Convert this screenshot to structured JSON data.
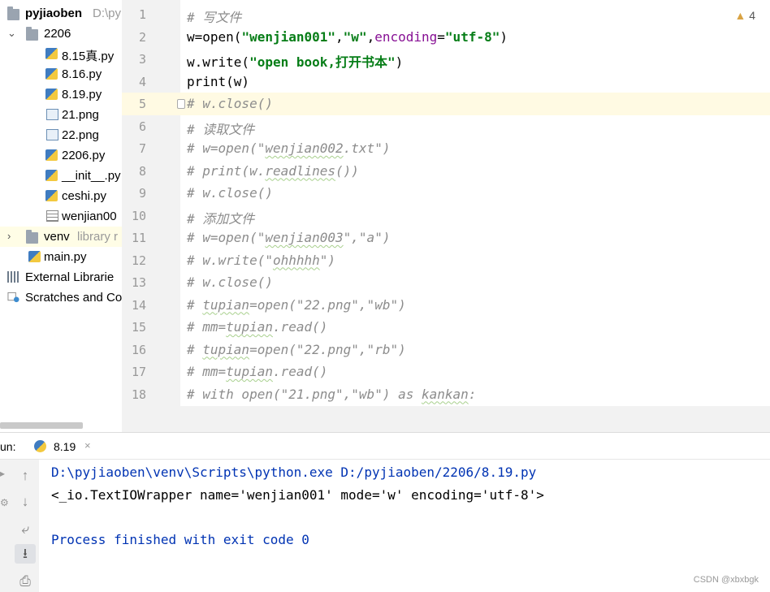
{
  "project_tree": {
    "root_name": "pyjiaoben",
    "root_path": "D:\\py",
    "folder_2206": "2206",
    "files": [
      "8.15真.py",
      "8.16.py",
      "8.19.py",
      "21.png",
      "22.png",
      "2206.py",
      "__init__.py",
      "ceshi.py",
      "wenjian00"
    ],
    "venv": "venv",
    "venv_hint": "library r",
    "main": "main.py",
    "external_libraries": "External Librarie",
    "scratches": "Scratches and Co"
  },
  "editor": {
    "line_numbers": [
      "1",
      "2",
      "3",
      "4",
      "5",
      "6",
      "7",
      "8",
      "9",
      "10",
      "11",
      "12",
      "13",
      "14",
      "15",
      "16",
      "17",
      "18"
    ],
    "warnings_count": "4",
    "current_line": 5
  },
  "run_panel": {
    "label": "un:",
    "tab_name": "8.19",
    "tab_close": "×",
    "output": [
      "D:\\pyjiaoben\\venv\\Scripts\\python.exe D:/pyjiaoben/2206/8.19.py",
      "<_io.TextIOWrapper name='wenjian001' mode='w' encoding='utf-8'>",
      "",
      "Process finished with exit code 0"
    ]
  },
  "icons": {
    "up": "arrow-up-icon",
    "down": "arrow-down-icon",
    "wrap": "soft-wrap-icon",
    "scroll": "scroll-to-end-icon",
    "print": "print-icon"
  },
  "watermark": "CSDN @xbxbgk"
}
